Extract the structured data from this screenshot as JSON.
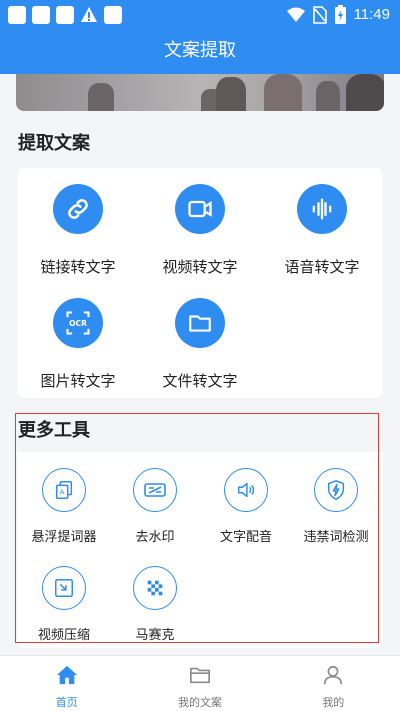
{
  "status_bar": {
    "time": "11:49"
  },
  "app_bar": {
    "title": "文案提取"
  },
  "extract_section": {
    "title": "提取文案",
    "items": [
      {
        "label": "链接转文字",
        "icon": "link-icon"
      },
      {
        "label": "视频转文字",
        "icon": "video-camera-icon"
      },
      {
        "label": "语音转文字",
        "icon": "audio-wave-icon"
      },
      {
        "label": "图片转文字",
        "icon": "ocr-scan-icon"
      },
      {
        "label": "文件转文字",
        "icon": "folder-icon"
      }
    ]
  },
  "tools_section": {
    "title": "更多工具",
    "items": [
      {
        "label": "悬浮提词器",
        "icon": "floating-prompter-icon"
      },
      {
        "label": "去水印",
        "icon": "watermark-remove-icon"
      },
      {
        "label": "文字配音",
        "icon": "speaker-icon"
      },
      {
        "label": "违禁词检测",
        "icon": "shield-bolt-icon"
      },
      {
        "label": "视频压缩",
        "icon": "compress-icon"
      },
      {
        "label": "马赛克",
        "icon": "mosaic-icon"
      }
    ]
  },
  "tab_bar": {
    "tabs": [
      {
        "label": "首页",
        "icon": "home-icon",
        "active": true
      },
      {
        "label": "我的文案",
        "icon": "folder-tab-icon",
        "active": false
      },
      {
        "label": "我的",
        "icon": "user-icon",
        "active": false
      }
    ]
  },
  "colors": {
    "primary": "#2f8cf0",
    "highlight": "#e33a3a"
  }
}
